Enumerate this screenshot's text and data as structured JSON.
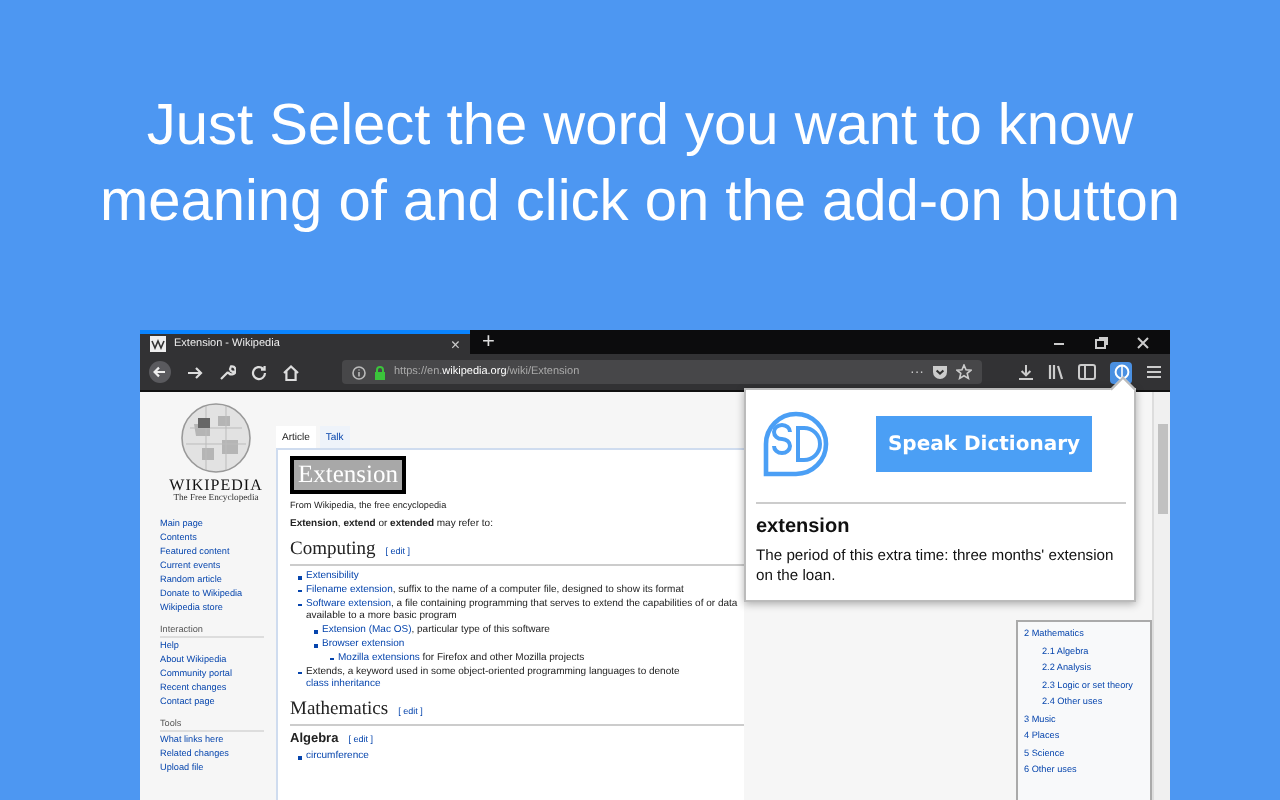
{
  "headline": "Just Select the word you want to know meaning of and click on the add-on button",
  "browser": {
    "tabs": [
      {
        "title": "Extension - Wikipedia",
        "close": "×",
        "selected": true
      }
    ],
    "new_tab": "+",
    "url": "https://en.**wikipedia.org**/wiki/Extension",
    "page_actions": "···",
    "extension_button_active": true
  },
  "wikipedia": {
    "logo_title": "WIKIPEDIA",
    "logo_tagline": "The Free Encyclopedia",
    "sidebar": [
      {
        "items": [
          "Main page",
          "Contents",
          "Featured content",
          "Current events",
          "Random article",
          "Donate to Wikipedia",
          "Wikipedia store"
        ]
      },
      {
        "heading": "Interaction",
        "items": [
          "Help",
          "About Wikipedia",
          "Community portal",
          "Recent changes",
          "Contact page"
        ]
      },
      {
        "heading": "Tools",
        "items": [
          "What links here",
          "Related changes",
          "Upload file"
        ]
      }
    ],
    "page_tabs": [
      {
        "label": "Article",
        "selected": true
      },
      {
        "label": "Talk",
        "selected": false
      }
    ],
    "title": "Extension",
    "title_selected": true,
    "subtitle": "From Wikipedia, the free encyclopedia",
    "intro": "**Extension**, **extend** or **extended** may refer to:",
    "sections": [
      {
        "kind": "h2",
        "title": "Computing",
        "edit": "[ edit ]",
        "items": [
          {
            "parts": [
              {
                "text": "Extensibility",
                "link": true
              }
            ]
          },
          {
            "parts": [
              {
                "text": "Filename extension",
                "link": true
              },
              {
                "text": ", suffix to the name of a computer file, designed to show its format",
                "link": false
              }
            ]
          },
          {
            "parts": [
              {
                "text": "Software extension",
                "link": true
              },
              {
                "text": ", a file containing programming that serves to extend the capabilities of or data available to a more basic program",
                "link": false
              }
            ],
            "children": [
              {
                "parts": [
                  {
                    "text": "Extension (Mac OS)",
                    "link": true
                  },
                  {
                    "text": ", particular type of this software",
                    "link": false
                  }
                ]
              },
              {
                "parts": [
                  {
                    "text": "Browser extension",
                    "link": true
                  }
                ],
                "children": [
                  {
                    "parts": [
                      {
                        "text": "Mozilla extensions",
                        "link": true
                      },
                      {
                        "text": " for Firefox and other Mozilla projects",
                        "link": false
                      }
                    ]
                  }
                ]
              }
            ]
          },
          {
            "parts": [
              {
                "text": "Extends, a keyword used in some object-oriented programming languages to denote ",
                "link": false
              },
              {
                "text": "class inheritance",
                "link": true
              }
            ]
          }
        ]
      },
      {
        "kind": "h2",
        "title": "Mathematics",
        "edit": "[ edit ]"
      },
      {
        "kind": "h3",
        "title": "Algebra",
        "edit": "[ edit ]",
        "items": [
          {
            "parts": [
              {
                "text": "circumference",
                "link": true
              }
            ]
          }
        ]
      }
    ],
    "toc": [
      {
        "label": "2 Mathematics",
        "children": [
          {
            "label": "2.1 Algebra"
          },
          {
            "label": "2.2 Analysis"
          },
          {
            "label": "2.3 Logic or set theory"
          },
          {
            "label": "2.4 Other uses"
          }
        ]
      },
      {
        "label": "3 Music"
      },
      {
        "label": "4 Places"
      },
      {
        "label": "5 Science"
      },
      {
        "label": "6 Other uses"
      }
    ]
  },
  "popup": {
    "button": "Speak Dictionary",
    "word": "extension",
    "definition": "The period of this extra time: three months' extension on the loan."
  }
}
